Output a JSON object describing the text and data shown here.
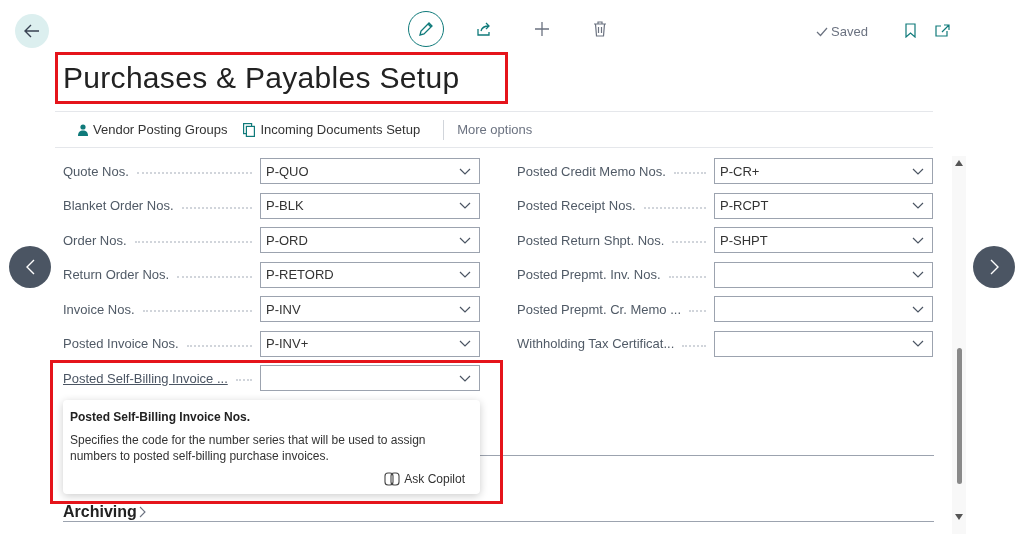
{
  "status": "Saved",
  "title": "Purchases & Payables Setup",
  "actions": [
    {
      "kind": "person",
      "label": "Vendor Posting Groups"
    },
    {
      "kind": "document",
      "label": "Incoming Documents Setup"
    },
    {
      "kind": "more",
      "label": "More options"
    }
  ],
  "fields_left": [
    {
      "kind": "field",
      "label": "Quote Nos.",
      "value": "P-QUO"
    },
    {
      "kind": "field",
      "label": "Blanket Order Nos.",
      "value": "P-BLK"
    },
    {
      "kind": "field",
      "label": "Order Nos.",
      "value": "P-ORD"
    },
    {
      "kind": "field",
      "label": "Return Order Nos.",
      "value": "P-RETORD"
    },
    {
      "kind": "field",
      "label": "Invoice Nos.",
      "value": "P-INV"
    },
    {
      "kind": "field",
      "label": "Posted Invoice Nos.",
      "value": "P-INV+"
    },
    {
      "kind": "link",
      "label": "Posted Self-Billing Invoice ..."
    }
  ],
  "fields_right": [
    {
      "kind": "field",
      "label": "Posted Credit Memo Nos.",
      "value": "P-CR+"
    },
    {
      "kind": "field",
      "label": "Posted Receipt Nos.",
      "value": "P-RCPT"
    },
    {
      "kind": "field",
      "label": "Posted Return Shpt. Nos.",
      "value": "P-SHPT"
    },
    {
      "kind": "field",
      "label": "Posted Prepmt. Inv. Nos."
    },
    {
      "kind": "field",
      "label": "Posted Prepmt. Cr. Memo ..."
    },
    {
      "kind": "field",
      "label": "Withholding Tax Certificat..."
    }
  ],
  "tooltip": {
    "title": "Posted Self-Billing Invoice Nos.",
    "body": "Specifies the code for the number series that will be used to assign numbers to posted self-billing purchase invoices.",
    "action": "Ask Copilot"
  },
  "sections": [
    {
      "title": "Archiving"
    }
  ]
}
